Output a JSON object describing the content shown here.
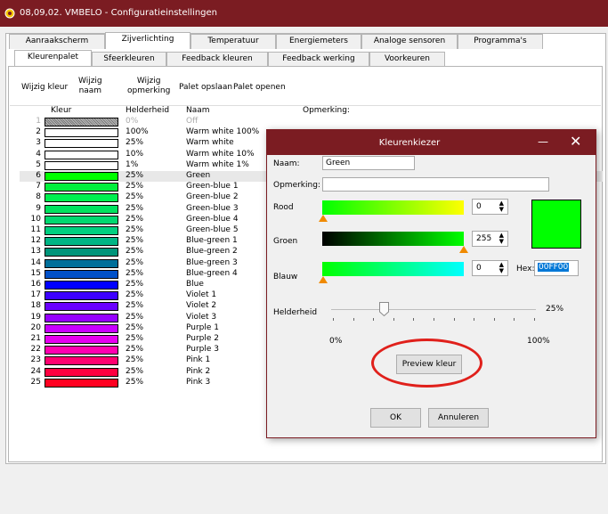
{
  "window": {
    "title": "08,09,02. VMBELO - Configuratieinstellingen"
  },
  "tabs_main": [
    {
      "label": "Aanraakscherm",
      "selected": false
    },
    {
      "label": "Zijverlichting",
      "selected": true
    },
    {
      "label": "Temperatuur",
      "selected": false
    },
    {
      "label": "Energiemeters",
      "selected": false
    },
    {
      "label": "Analoge sensoren",
      "selected": false
    },
    {
      "label": "Programma's",
      "selected": false
    }
  ],
  "tabs_sub": [
    {
      "label": "Kleurenpalet",
      "selected": true
    },
    {
      "label": "Sfeerkleuren",
      "selected": false
    },
    {
      "label": "Feedback kleuren",
      "selected": false
    },
    {
      "label": "Feedback werking",
      "selected": false
    },
    {
      "label": "Voorkeuren",
      "selected": false
    }
  ],
  "toolbar": {
    "wijzig_kleur": "Wijzig kleur",
    "wijzig_naam_1": "Wijzig",
    "wijzig_naam_2": "naam",
    "wijzig_opm_1": "Wijzig",
    "wijzig_opm_2": "opmerking",
    "palet_opslaan": "Palet opslaan",
    "palet_openen": "Palet openen"
  },
  "columns": {
    "kleur": "Kleur",
    "helderheid": "Helderheid",
    "naam": "Naam",
    "opmerking": "Opmerking:"
  },
  "rows": [
    {
      "num": "1",
      "color": "#9a9a9a",
      "brightness": "0%",
      "name": "Off",
      "dim": true
    },
    {
      "num": "2",
      "color": "#ffffff",
      "brightness": "100%",
      "name": "Warm white 100%"
    },
    {
      "num": "3",
      "color": "#ffffff",
      "brightness": "25%",
      "name": "Warm white"
    },
    {
      "num": "4",
      "color": "#ffffff",
      "brightness": "10%",
      "name": "Warm white 10%"
    },
    {
      "num": "5",
      "color": "#ffffff",
      "brightness": "1%",
      "name": "Warm white 1%"
    },
    {
      "num": "6",
      "color": "#00ff00",
      "brightness": "25%",
      "name": "Green",
      "selected": true
    },
    {
      "num": "7",
      "color": "#00f03c",
      "brightness": "25%",
      "name": "Green-blue 1"
    },
    {
      "num": "8",
      "color": "#00f050",
      "brightness": "25%",
      "name": "Green-blue 2"
    },
    {
      "num": "9",
      "color": "#00e25f",
      "brightness": "25%",
      "name": "Green-blue 3"
    },
    {
      "num": "10",
      "color": "#00d870",
      "brightness": "25%",
      "name": "Green-blue 4"
    },
    {
      "num": "11",
      "color": "#00cf80",
      "brightness": "25%",
      "name": "Green-blue 5"
    },
    {
      "num": "12",
      "color": "#00b585",
      "brightness": "25%",
      "name": "Blue-green 1"
    },
    {
      "num": "13",
      "color": "#00957a",
      "brightness": "25%",
      "name": "Blue-green 2"
    },
    {
      "num": "14",
      "color": "#006f9a",
      "brightness": "25%",
      "name": "Blue-green 3"
    },
    {
      "num": "15",
      "color": "#0050c8",
      "brightness": "25%",
      "name": "Blue-green 4"
    },
    {
      "num": "16",
      "color": "#0000ff",
      "brightness": "25%",
      "name": "Blue"
    },
    {
      "num": "17",
      "color": "#3c00ff",
      "brightness": "25%",
      "name": "Violet 1"
    },
    {
      "num": "18",
      "color": "#6a00ff",
      "brightness": "25%",
      "name": "Violet 2"
    },
    {
      "num": "19",
      "color": "#9600ff",
      "brightness": "25%",
      "name": "Violet 3"
    },
    {
      "num": "20",
      "color": "#c800ff",
      "brightness": "25%",
      "name": "Purple 1"
    },
    {
      "num": "21",
      "color": "#e600f0",
      "brightness": "25%",
      "name": "Purple 2"
    },
    {
      "num": "22",
      "color": "#ff00b0",
      "brightness": "25%",
      "name": "Purple 3"
    },
    {
      "num": "23",
      "color": "#ff0070",
      "brightness": "25%",
      "name": "Pink 1"
    },
    {
      "num": "24",
      "color": "#ff0040",
      "brightness": "25%",
      "name": "Pink 2"
    },
    {
      "num": "25",
      "color": "#ff0020",
      "brightness": "25%",
      "name": "Pink 3"
    }
  ],
  "dialog": {
    "title": "Kleurenkiezer",
    "naam_label": "Naam:",
    "naam_value": "Green",
    "opmerking_label": "Opmerking:",
    "opmerking_value": "",
    "rood_label": "Rood",
    "rood_value": "0",
    "groen_label": "Groen",
    "groen_value": "255",
    "blauw_label": "Blauw",
    "blauw_value": "0",
    "hex_label": "Hex:",
    "hex_value": "00FF00",
    "preview_color": "#00ff00",
    "helderheid_label": "Helderheid",
    "helderheid_value": "25%",
    "helderheid_level": 0.25,
    "min_label": "0%",
    "max_label": "100%",
    "preview_button": "Preview kleur",
    "ok_button": "OK",
    "cancel_button": "Annuleren"
  },
  "colors": {
    "titlebar": "#7b1c22",
    "highlight_ring": "#e0201b",
    "slider_thumb": "#f08a00"
  }
}
